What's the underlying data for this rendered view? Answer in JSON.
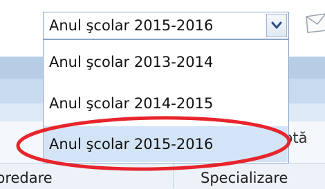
{
  "select": {
    "selected_value": "Anul şcolar 2015-2016",
    "options": [
      {
        "label": "Anul şcolar 2013-2014",
        "selected": false
      },
      {
        "label": "Anul şcolar 2014-2015",
        "selected": false
      },
      {
        "label": "Anul şcolar 2015-2016",
        "selected": true
      }
    ]
  },
  "table_header": {
    "col1": "predare",
    "col2": "Specializare"
  },
  "background": {
    "partial_text": "ptă"
  },
  "colors": {
    "highlight_circle": "#e8242c",
    "selected_option_bg": "#d4e4f7",
    "select_border": "#8aa4c8"
  },
  "icons": {
    "dropdown_arrow": "chevron-down-icon",
    "envelope": "envelope-icon"
  }
}
